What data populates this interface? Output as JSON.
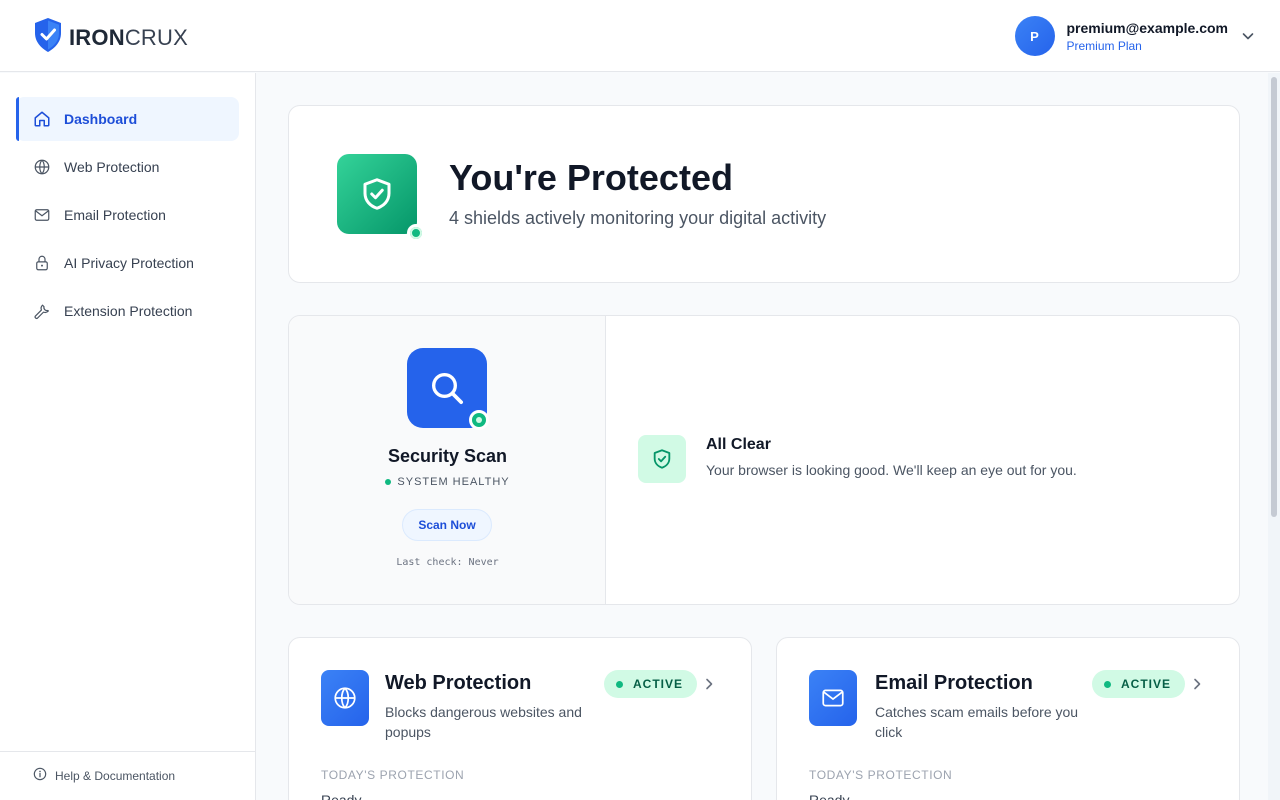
{
  "brand": {
    "name_bold": "IRON",
    "name_light": "CRUX",
    "color": "#2563eb"
  },
  "account": {
    "avatar_letter": "P",
    "email": "premium@example.com",
    "plan": "Premium Plan"
  },
  "sidebar": {
    "items": [
      {
        "label": "Dashboard",
        "icon": "home-icon",
        "active": true
      },
      {
        "label": "Web Protection",
        "icon": "globe-icon",
        "active": false
      },
      {
        "label": "Email Protection",
        "icon": "mail-icon",
        "active": false
      },
      {
        "label": "AI Privacy Protection",
        "icon": "lock-icon",
        "active": false
      },
      {
        "label": "Extension Protection",
        "icon": "wrench-icon",
        "active": false
      }
    ],
    "help_label": "Help & Documentation"
  },
  "hero": {
    "title": "You're Protected",
    "subtitle": "4 shields actively monitoring your digital activity"
  },
  "scan": {
    "title": "Security Scan",
    "status": "SYSTEM HEALTHY",
    "button_label": "Scan Now",
    "last_check": "Last check: Never",
    "result_title": "All Clear",
    "result_text": "Your browser is looking good. We'll keep an eye out for you."
  },
  "features": [
    {
      "title": "Web Protection",
      "description": "Blocks dangerous websites and popups",
      "status": "ACTIVE",
      "section_label": "TODAY'S PROTECTION",
      "value": "Ready",
      "icon": "globe-icon"
    },
    {
      "title": "Email Protection",
      "description": "Catches scam emails before you click",
      "status": "ACTIVE",
      "section_label": "TODAY'S PROTECTION",
      "value": "Ready",
      "icon": "mail-icon"
    }
  ],
  "colors": {
    "accent": "#2563eb",
    "success": "#10b981",
    "success_bg": "#d1fae5"
  }
}
